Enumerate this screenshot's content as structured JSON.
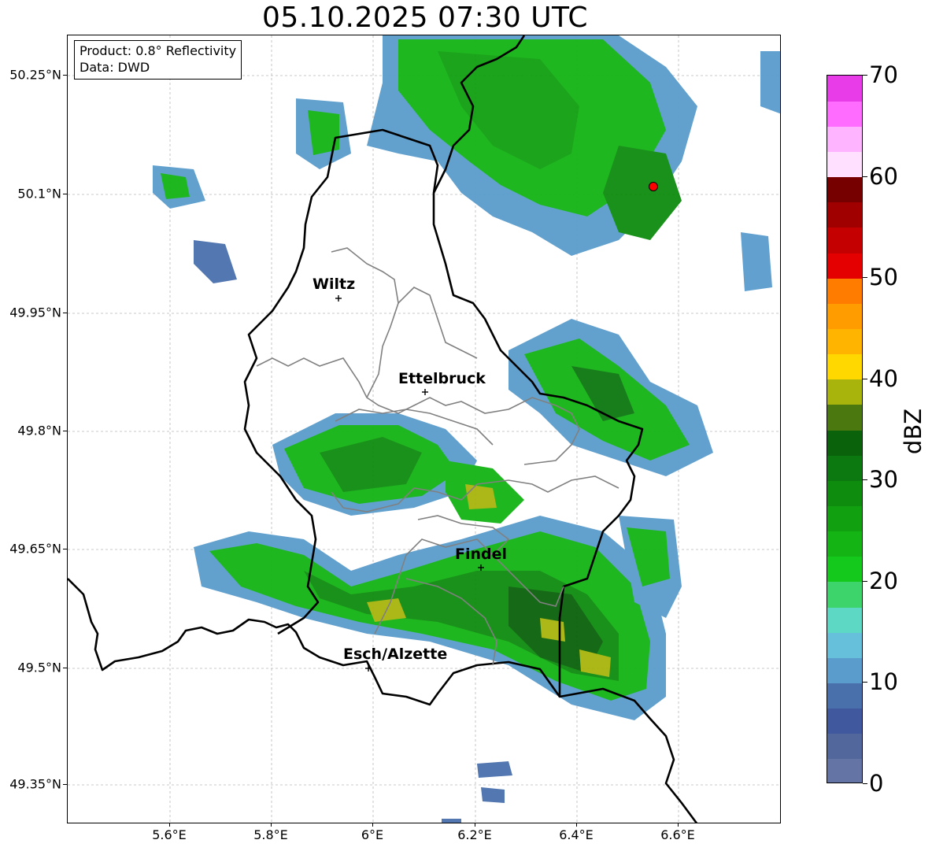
{
  "title": "05.10.2025 07:30 UTC",
  "info": {
    "product": "Product: 0.8° Reflectivity",
    "data": "Data: DWD"
  },
  "axes": {
    "lat_labels": [
      "50.25°N",
      "50.1°N",
      "49.95°N",
      "49.8°N",
      "49.65°N",
      "49.5°N",
      "49.35°N"
    ],
    "lon_labels": [
      "5.6°E",
      "5.8°E",
      "6°E",
      "6.2°E",
      "6.4°E",
      "6.6°E"
    ]
  },
  "cities": [
    {
      "name": "Wiltz"
    },
    {
      "name": "Ettelbruck"
    },
    {
      "name": "Findel"
    },
    {
      "name": "Esch/Alzette"
    }
  ],
  "radar_site": {
    "color": "#ff0000"
  },
  "colorbar": {
    "label": "dBZ",
    "min": 0,
    "max": 70,
    "tick_labels": [
      "0",
      "10",
      "20",
      "30",
      "40",
      "50",
      "60",
      "70"
    ],
    "colors": [
      "#6474a4",
      "#52689c",
      "#40589e",
      "#4a70ac",
      "#5a9ccc",
      "#66c0dc",
      "#5cd8c4",
      "#3ed46c",
      "#14c81c",
      "#14b414",
      "#10a010",
      "#0e8c0e",
      "#0c7810",
      "#0a620a",
      "#4c7810",
      "#a8b40c",
      "#ffd800",
      "#ffb400",
      "#ff9c00",
      "#ff7c00",
      "#e40000",
      "#c40000",
      "#a00000",
      "#760000",
      "#ffe0ff",
      "#ffb4ff",
      "#ff6cff",
      "#e83ce8"
    ]
  }
}
